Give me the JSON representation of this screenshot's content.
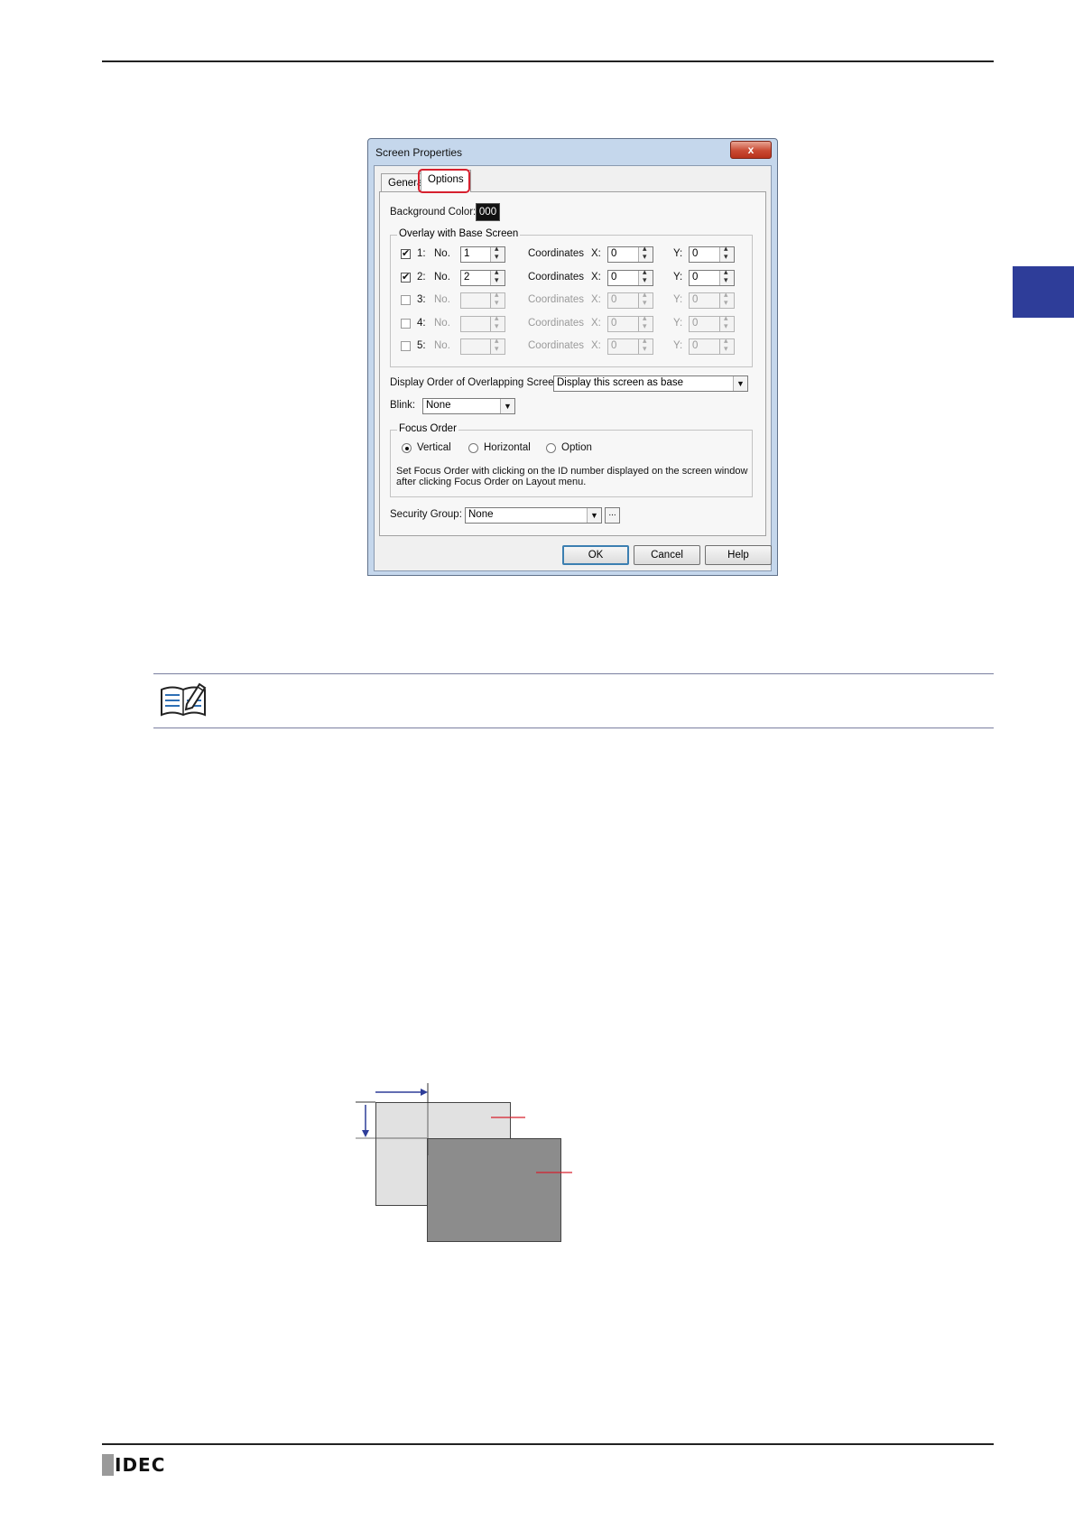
{
  "dialog": {
    "title": "Screen Properties",
    "close_label": "x",
    "tabs": {
      "general": "General",
      "options": "Options"
    },
    "background_color": {
      "label": "Background Color:",
      "value": "000"
    },
    "overlay": {
      "title": "Overlay with Base Screen",
      "no_label": "No.",
      "coordinates_label": "Coordinates",
      "x_label": "X:",
      "y_label": "Y:",
      "rows": [
        {
          "index": "1:",
          "checked": true,
          "no": "1",
          "x": "0",
          "y": "0"
        },
        {
          "index": "2:",
          "checked": true,
          "no": "2",
          "x": "0",
          "y": "0"
        },
        {
          "index": "3:",
          "checked": false,
          "no": "",
          "x": "0",
          "y": "0"
        },
        {
          "index": "4:",
          "checked": false,
          "no": "",
          "x": "0",
          "y": "0"
        },
        {
          "index": "5:",
          "checked": false,
          "no": "",
          "x": "0",
          "y": "0"
        }
      ]
    },
    "display_order": {
      "label": "Display Order of Overlapping Screens:",
      "value": "Display this screen as base"
    },
    "blink": {
      "label": "Blink:",
      "value": "None"
    },
    "focus_order": {
      "title": "Focus Order",
      "options": [
        "Vertical",
        "Horizontal",
        "Option"
      ],
      "selected": "Vertical",
      "note_line1": "Set Focus Order with clicking on the ID number displayed on the screen window",
      "note_line2": "after clicking Focus Order on Layout menu."
    },
    "security_group": {
      "label": "Security Group:",
      "value": "None",
      "browse_label": "..."
    },
    "buttons": {
      "ok": "OK",
      "cancel": "Cancel",
      "help": "Help"
    }
  },
  "footer": {
    "logo": "IDEC"
  },
  "colors": {
    "accent_tab": "#2e3d99",
    "highlight": "#d6202e",
    "overlay_dark": "#8c8c8c",
    "base_light": "#e1e1e1",
    "arrow": "#2e3d99"
  }
}
